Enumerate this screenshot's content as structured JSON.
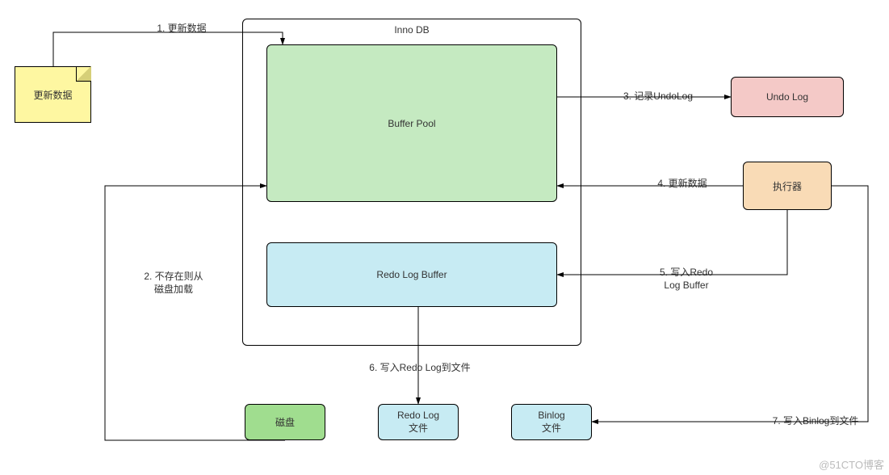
{
  "watermark": "@51CTO博客",
  "innodb": {
    "title": "Inno DB"
  },
  "nodes": {
    "update_note": "更新数据",
    "buffer_pool": "Buffer Pool",
    "redo_buffer": "Redo Log Buffer",
    "undo_log": "Undo Log",
    "executor": "执行器",
    "disk": "磁盘",
    "redo_file": "Redo Log\n文件",
    "binlog_file": "Binlog\n文件"
  },
  "edges": {
    "e1": "1. 更新数据",
    "e2": "2. 不存在则从\n磁盘加载",
    "e3": "3. 记录UndoLog",
    "e4": "4. 更新数据",
    "e5": "5. 写入Redo\nLog Buffer",
    "e6": "6. 写入Redo Log到文件",
    "e7": "7. 写入Binlog到文件"
  }
}
